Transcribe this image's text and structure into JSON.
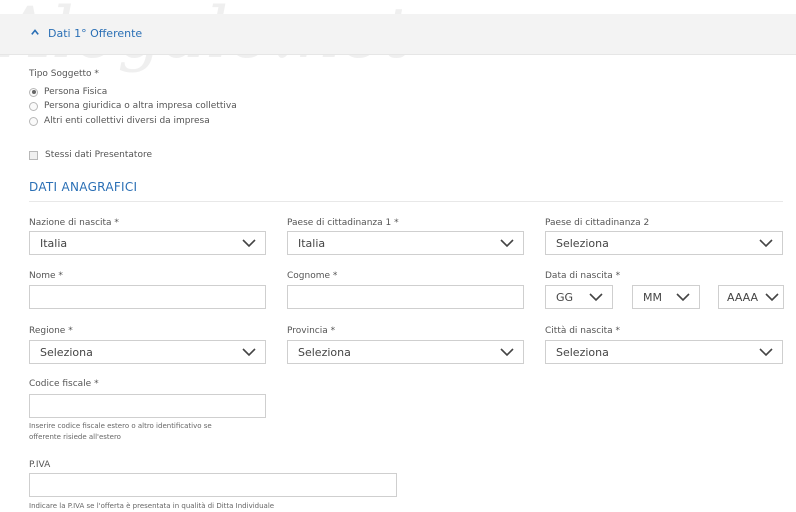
{
  "watermark": "Alegale.net",
  "section": {
    "title": "Dati 1° Offerente"
  },
  "tipo_soggetto": {
    "label": "Tipo Soggetto *",
    "options": [
      {
        "label": "Persona Fisica",
        "selected": true
      },
      {
        "label": "Persona giuridica o altra impresa collettiva",
        "selected": false
      },
      {
        "label": "Altri enti collettivi diversi da impresa",
        "selected": false
      }
    ]
  },
  "stessi_dati": {
    "label": "Stessi dati Presentatore",
    "checked": false
  },
  "dati_anagrafici": {
    "title": "DATI ANAGRAFICI",
    "nazione_nascita": {
      "label": "Nazione di nascita  *",
      "value": "Italia"
    },
    "paese_cittadinanza1": {
      "label": "Paese di cittadinanza 1  *",
      "value": "Italia"
    },
    "paese_cittadinanza2": {
      "label": "Paese di cittadinanza 2",
      "value": "Seleziona"
    },
    "nome": {
      "label": "Nome *",
      "value": ""
    },
    "cognome": {
      "label": "Cognome *",
      "value": ""
    },
    "data_nascita": {
      "label": "Data di nascita  *",
      "day": "GG",
      "month": "MM",
      "year": "AAAA"
    },
    "regione": {
      "label": "Regione  *",
      "value": "Seleziona"
    },
    "provincia": {
      "label": "Provincia  *",
      "value": "Seleziona"
    },
    "citta_nascita": {
      "label": "Città di nascita  *",
      "value": "Seleziona"
    },
    "codice_fiscale": {
      "label": "Codice fiscale  *",
      "value": "",
      "help_line1": "Inserire codice fiscale estero o altro identificativo se",
      "help_line2": "offerente risiede all'estero"
    },
    "piva": {
      "label": "P.IVA",
      "value": "",
      "help": "Indicare la P.IVA se l'offerta è presentata in qualità di Ditta Individuale"
    }
  },
  "colors": {
    "accent": "#2a6fb5",
    "border": "#cfcfcf",
    "header_bg": "#f3f3f3"
  }
}
